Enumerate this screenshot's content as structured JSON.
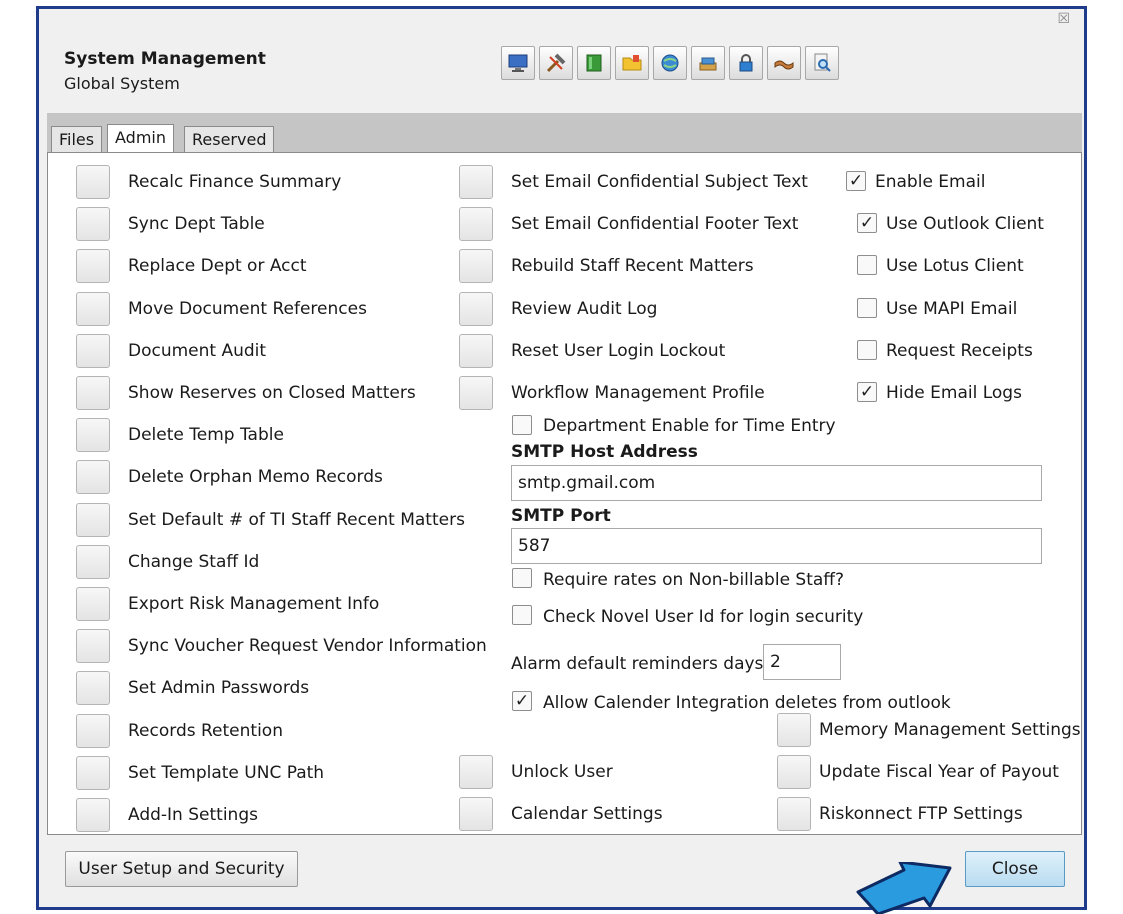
{
  "window": {
    "close_glyph": "☒",
    "title": "System Management",
    "subtitle": "Global System"
  },
  "toolbar": {
    "icons": [
      "computer-icon",
      "tools-icon",
      "book-icon",
      "folder-icon",
      "globe-icon",
      "stack-icon",
      "lock-icon",
      "handshake-icon",
      "magnifier-icon"
    ]
  },
  "tabs": [
    "Files",
    "Admin",
    "Reserved"
  ],
  "active_tab": "Admin",
  "left_actions": [
    "Recalc Finance Summary",
    "Sync Dept Table",
    "Replace Dept or Acct",
    "Move Document References",
    "Document Audit",
    "Show Reserves on Closed Matters",
    "Delete Temp Table",
    "Delete Orphan Memo Records",
    "Set Default # of TI Staff Recent Matters",
    "Change Staff Id",
    "Export Risk Management Info",
    "Sync Voucher Request Vendor Information",
    "Set Admin Passwords",
    "Records Retention",
    "Set Template UNC Path",
    "Add-In Settings"
  ],
  "middle_actions": [
    "Set Email Confidential Subject Text",
    "Set Email Confidential Footer Text",
    "Rebuild Staff Recent Matters",
    "Review Audit Log",
    "Reset User Login Lockout",
    "Workflow Management Profile"
  ],
  "email_options": [
    {
      "label": "Enable Email",
      "checked": true
    },
    {
      "label": "Use Outlook Client",
      "checked": true
    },
    {
      "label": "Use Lotus Client",
      "checked": false
    },
    {
      "label": "Use MAPI Email",
      "checked": false
    },
    {
      "label": "Request Receipts",
      "checked": false
    },
    {
      "label": "Hide Email Logs",
      "checked": true
    }
  ],
  "dept_enable": {
    "label": "Department Enable for Time Entry",
    "checked": false
  },
  "smtp": {
    "host_label": "SMTP Host Address",
    "host_value": "smtp.gmail.com",
    "port_label": "SMTP Port",
    "port_value": "587"
  },
  "require_rates": {
    "label": "Require rates on Non-billable Staff?",
    "checked": false
  },
  "novel_check": {
    "label": "Check Novel User Id for login security",
    "checked": false
  },
  "alarm": {
    "label": "Alarm default reminders days",
    "value": "2"
  },
  "calendar_integration": {
    "label": "Allow Calender Integration deletes from outlook",
    "checked": true
  },
  "right_bottom_actions": [
    "Memory Management Settings",
    "Update Fiscal Year of Payout",
    "Riskonnect FTP Settings"
  ],
  "bottom_middle_actions": [
    "Unlock User",
    "Calendar Settings"
  ],
  "footer": {
    "user_setup_label": "User Setup and Security",
    "close_label": "Close"
  },
  "check_glyph": "✓",
  "colors": {
    "frame": "#1f3b8c",
    "pointer_fill": "#2b9be0",
    "pointer_stroke": "#0d2a63"
  }
}
